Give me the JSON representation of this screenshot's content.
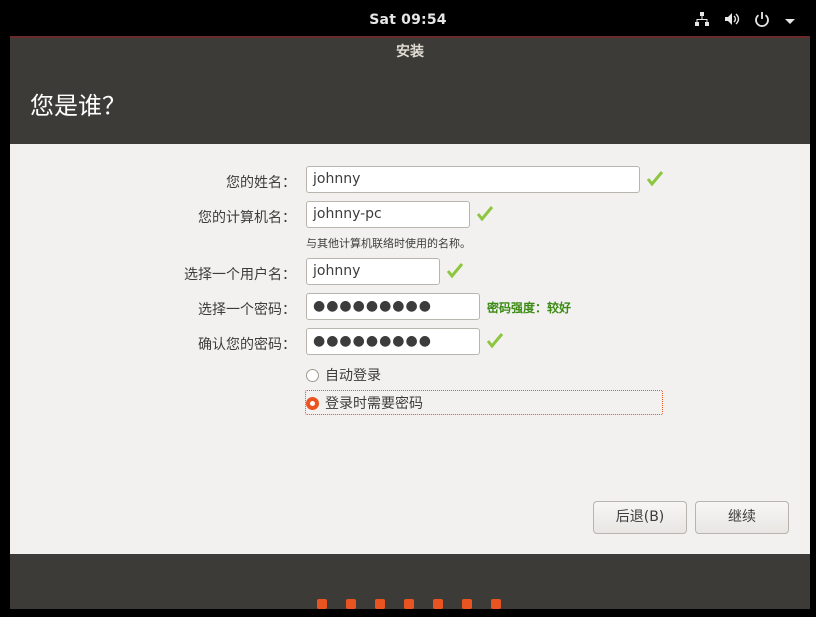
{
  "topbar": {
    "clock": "Sat 09:54",
    "icons": [
      "network-icon",
      "volume-icon",
      "power-icon",
      "menu-arrow-icon"
    ]
  },
  "window": {
    "title": "安装",
    "heading": "您是谁？"
  },
  "form": {
    "name": {
      "label": "您的姓名：",
      "value": "johnny"
    },
    "computer": {
      "label": "您的计算机名：",
      "value": "johnny-pc",
      "hint": "与其他计算机联络时使用的名称。"
    },
    "username": {
      "label": "选择一个用户名：",
      "value": "johnny"
    },
    "password": {
      "label": "选择一个密码：",
      "value": "●●●●●●●●●",
      "strength": "密码强度：较好"
    },
    "confirm": {
      "label": "确认您的密码：",
      "value": "●●●●●●●●●"
    },
    "login_options": [
      {
        "label": "自动登录",
        "selected": false
      },
      {
        "label": "登录时需要密码",
        "selected": true
      }
    ]
  },
  "buttons": {
    "back": "后退(B)",
    "continue": "继续"
  },
  "progress": {
    "steps": 7,
    "color": "#e95420"
  },
  "colors": {
    "accent": "#e95420",
    "ok": "#8dc63f",
    "strength": "#3c8b14",
    "chrome": "#3c3b37"
  }
}
